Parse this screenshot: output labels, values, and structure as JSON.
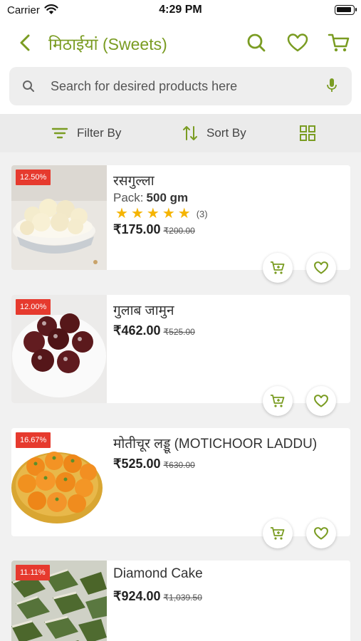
{
  "status": {
    "carrier": "Carrier",
    "time": "4:29 PM"
  },
  "header": {
    "title": "मिठाईयां (Sweets)"
  },
  "search": {
    "placeholder": "Search for desired products here"
  },
  "filter_bar": {
    "filter_label": "Filter By",
    "sort_label": "Sort By"
  },
  "colors": {
    "accent": "#7a9c22",
    "badge": "#e63a2e",
    "star": "#f5b400"
  },
  "products": [
    {
      "name": "रसगुल्ला",
      "discount": "12.50%",
      "pack_label": "Pack:",
      "pack_value": "500 gm",
      "rating": 5,
      "rating_count": "(3)",
      "price": "₹175.00",
      "mrp": "₹200.00"
    },
    {
      "name": "गुलाब जामुन",
      "discount": "12.00%",
      "price": "₹462.00",
      "mrp": "₹525.00"
    },
    {
      "name": "मोतीचूर लड्डू (MOTICHOOR LADDU)",
      "discount": "16.67%",
      "price": "₹525.00",
      "mrp": "₹630.00"
    },
    {
      "name": "Diamond Cake",
      "discount": "11.11%",
      "price": "₹924.00",
      "mrp": "₹1,039.50"
    }
  ]
}
